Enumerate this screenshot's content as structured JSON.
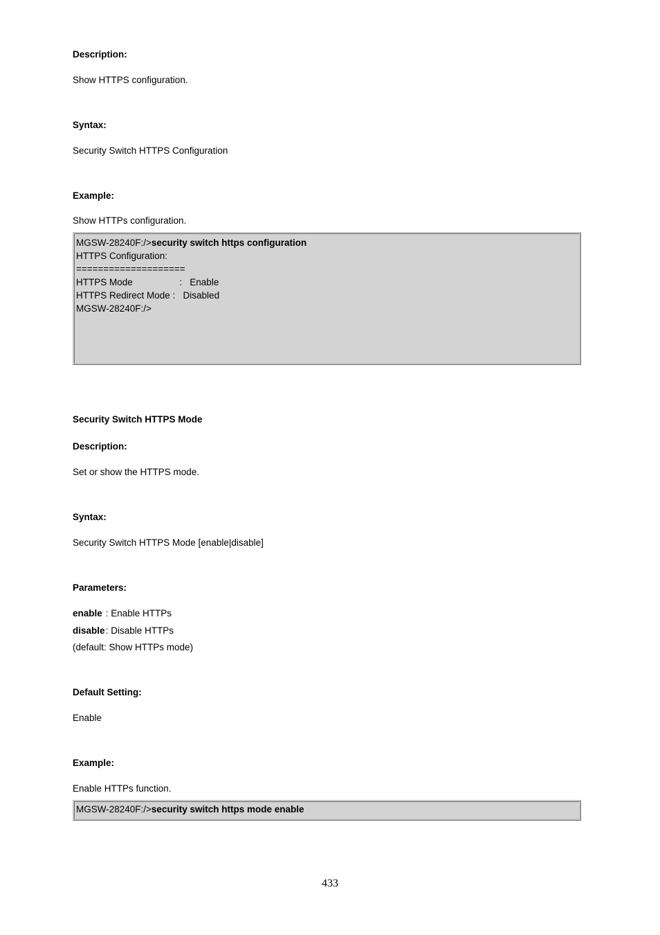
{
  "https_config": {
    "heading_desc": "Description:",
    "desc": "Show HTTPS configuration.",
    "heading_syntax": "Syntax:",
    "syntax": "Security Switch HTTPS Configuration",
    "heading_example": "Example:",
    "example_intro": "Show HTTPs configuration.",
    "box": {
      "prompt": "MGSW-28240F:/>",
      "cmd": "security switch https configuration",
      "lines": [
        "HTTPS Configuration:",
        "====================",
        "HTTPS Mode                  :   Enable",
        "HTTPS Redirect Mode :   Disabled",
        "MGSW-28240F:/>"
      ]
    }
  },
  "https_mode": {
    "cmd_title": "Security Switch HTTPS Mode",
    "heading_desc": "Description:",
    "desc": "Set or show the HTTPS mode.",
    "heading_syntax": "Syntax:",
    "syntax": "Security Switch HTTPS Mode [enable|disable]",
    "heading_params": "Parameters:",
    "params": {
      "enable_key": "enable",
      "enable_val": ": Enable HTTPs",
      "disable_key": "disable",
      "disable_val": ": Disable HTTPs"
    },
    "default_note": "(default: Show HTTPs mode)",
    "heading_default": "Default Setting:",
    "default_val": "Enable",
    "heading_example": "Example:",
    "example_intro": "Enable HTTPs function.",
    "box": {
      "prompt": "MGSW-28240F:/>",
      "cmd": "security switch https mode enable"
    }
  },
  "page_number": "433"
}
